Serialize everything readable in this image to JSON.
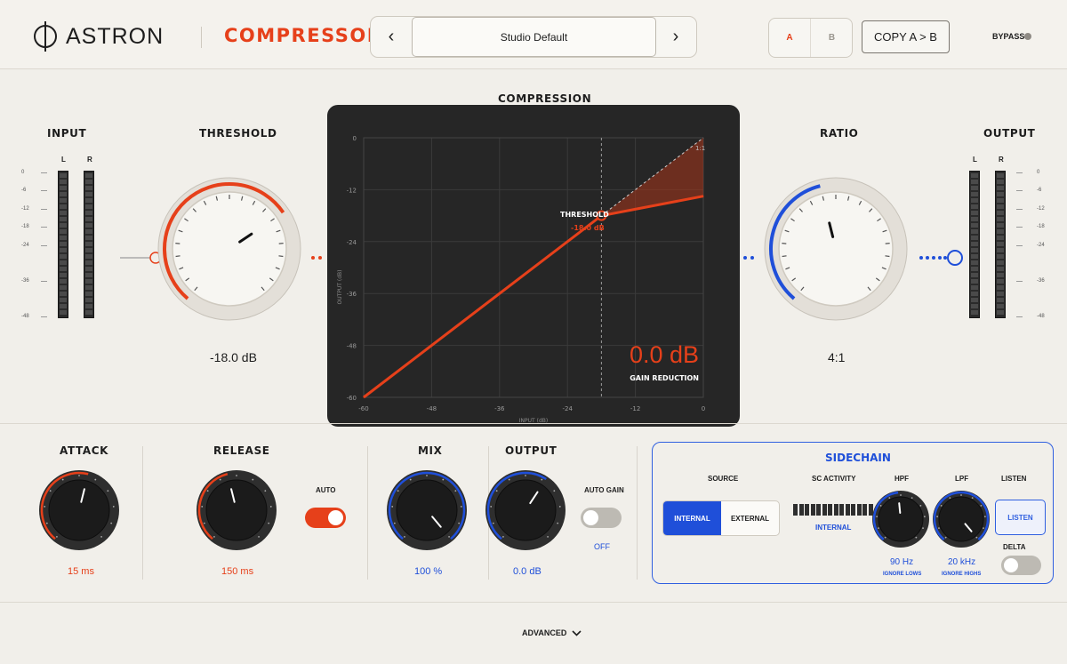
{
  "header": {
    "brand": "ASTRON",
    "plugin_name": "COMPRESSOR",
    "preset": "Studio Default",
    "preset_prev": "‹",
    "preset_next": "›",
    "ab_a": "A",
    "ab_b": "B",
    "copy_label": "COPY A > B",
    "bypass_label": "BYPASS"
  },
  "input": {
    "label": "INPUT",
    "left_label": "L",
    "right_label": "R",
    "scale": [
      "0",
      "-6",
      "-12",
      "-18",
      "-24",
      "-36",
      "-48"
    ]
  },
  "threshold": {
    "label": "THRESHOLD",
    "value": "-18.0 dB",
    "level": 0.7
  },
  "compression": {
    "title": "COMPRESSION",
    "y_axis_label": "OUTPUT (dB)",
    "x_axis_label": "INPUT (dB)",
    "threshold_tag": "THRESHOLD",
    "threshold_value": "-18.0 dB",
    "ratio_tag": "1:1",
    "gain_reduction_value": "0.0 dB",
    "gain_reduction_label": "GAIN REDUCTION"
  },
  "chart_data": {
    "type": "line",
    "x": [
      -60,
      -18,
      0
    ],
    "series": [
      {
        "values": [
          -60,
          -18,
          -13.5
        ]
      }
    ],
    "xlim": [
      -60,
      0
    ],
    "ylim": [
      -60,
      0
    ],
    "x_ticks": [
      "-60",
      "-48",
      "-36",
      "-24",
      "-12",
      "0"
    ],
    "y_ticks": [
      "0",
      "-12",
      "-24",
      "-36",
      "-48",
      "-60"
    ],
    "xlabel": "INPUT (dB)",
    "ylabel": "OUTPUT (dB)",
    "grid": true
  },
  "ratio": {
    "label": "RATIO",
    "value": "4:1",
    "level": 0.45
  },
  "output": {
    "label": "OUTPUT",
    "left_label": "L",
    "right_label": "R",
    "scale": [
      "0",
      "-6",
      "-12",
      "-18",
      "-24",
      "-36",
      "-48"
    ]
  },
  "attack": {
    "label": "ATTACK",
    "value": "15 ms",
    "level": 0.55
  },
  "release": {
    "label": "RELEASE",
    "value": "150 ms",
    "level": 0.45
  },
  "auto": {
    "label": "AUTO",
    "on": true
  },
  "mix": {
    "label": "MIX",
    "value": "100 %",
    "level": 1.0
  },
  "output_gain": {
    "label": "OUTPUT",
    "value": "0.0 dB",
    "level": 0.62
  },
  "auto_gain": {
    "label": "AUTO GAIN",
    "state": "OFF"
  },
  "sidechain": {
    "title": "SIDECHAIN",
    "source_label": "SOURCE",
    "source_internal": "INTERNAL",
    "source_external": "EXTERNAL",
    "activity_label": "SC ACTIVITY",
    "activity_source": "INTERNAL",
    "hpf": {
      "label": "HPF",
      "value": "90 Hz",
      "sub": "IGNORE LOWS",
      "level": 0.48
    },
    "lpf": {
      "label": "LPF",
      "value": "20 kHz",
      "sub": "IGNORE HIGHS",
      "level": 1.0
    },
    "listen_label": "LISTEN",
    "listen_button": "LISTEN",
    "delta_label": "DELTA"
  },
  "footer": {
    "advanced_label": "ADVANCED"
  },
  "colors": {
    "accent": "#e6401a",
    "blue": "#1f4fd9",
    "panel": "#262626",
    "background": "#f1efea"
  }
}
